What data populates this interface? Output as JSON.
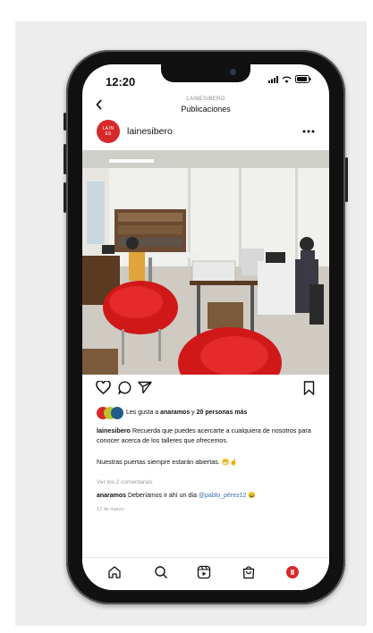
{
  "status_bar": {
    "time": "12:20"
  },
  "header": {
    "account_caption": "LAINESIBERO",
    "title": "Publicaciones"
  },
  "post": {
    "username": "lainesibero",
    "avatar_text": "LA IN ES",
    "likes": {
      "prefix": "Les gusta a ",
      "user": "anaramos",
      "joiner": " y ",
      "count_text": "20 personas más"
    },
    "caption": {
      "user": "lainesibero",
      "text": " Recuerda que puedes acercarte a cualquiera de nosotros para conocer acerca de los talleres que ofrecemos."
    },
    "caption_line2": "Nuestras puertas siempre estarán abiertas. 😁☝",
    "view_comments": "Ver los 2 comentarios",
    "comment": {
      "user": "anaramos",
      "text": " Deberíamos ir ahí un día ",
      "mention": "@pablo_pérez12",
      "emoji": " 😄"
    },
    "date": "12 de marzo"
  },
  "colors": {
    "brand_red": "#d62a2a",
    "like_dots": [
      "#d62a2a",
      "#b8c42a",
      "#1f5c8a"
    ]
  },
  "icons": {
    "actions": [
      "heart-icon",
      "comment-icon",
      "send-icon",
      "bookmark-icon"
    ],
    "tabs": [
      "home-icon",
      "search-icon",
      "reels-icon",
      "shop-icon",
      "profile-icon"
    ]
  }
}
